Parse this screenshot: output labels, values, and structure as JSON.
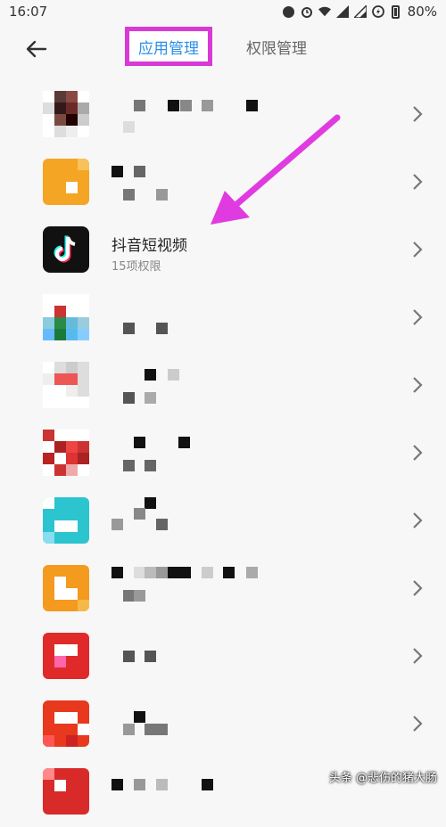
{
  "status_bar": {
    "time": "16:07",
    "battery": "80%",
    "icons": [
      "notification-dot-icon",
      "alarm-icon",
      "wifi-icon",
      "signal-icon",
      "signal-icon",
      "data-saver-icon",
      "battery-icon"
    ]
  },
  "header": {
    "back_icon": "back-arrow-icon",
    "tab_active": "应用管理",
    "tab_inactive": "权限管理",
    "highlight_color": "#d93ad6",
    "active_color": "#2a8fe6"
  },
  "apps": [
    {
      "icon": "app-icon-pixelated",
      "name": "",
      "sub": ""
    },
    {
      "icon": "app-icon-pixelated",
      "name": "",
      "sub": ""
    },
    {
      "icon": "tiktok-icon",
      "name": "抖音短视频",
      "sub": "15项权限"
    },
    {
      "icon": "app-icon-pixelated",
      "name": "",
      "sub": ""
    },
    {
      "icon": "app-icon-pixelated",
      "name": "",
      "sub": ""
    },
    {
      "icon": "app-icon-pixelated",
      "name": "",
      "sub": ""
    },
    {
      "icon": "app-icon-pixelated",
      "name": "",
      "sub": ""
    },
    {
      "icon": "app-icon-pixelated",
      "name": "",
      "sub": ""
    },
    {
      "icon": "app-icon-pixelated",
      "name": "",
      "sub": ""
    },
    {
      "icon": "app-icon-pixelated",
      "name": "",
      "sub": ""
    },
    {
      "icon": "app-icon-pixelated",
      "name": "",
      "sub": ""
    }
  ],
  "annotation": {
    "arrow_color": "#e03be0",
    "icon": "pointer-arrow-icon"
  },
  "watermark": "头条 @悲伤的猪大肠"
}
